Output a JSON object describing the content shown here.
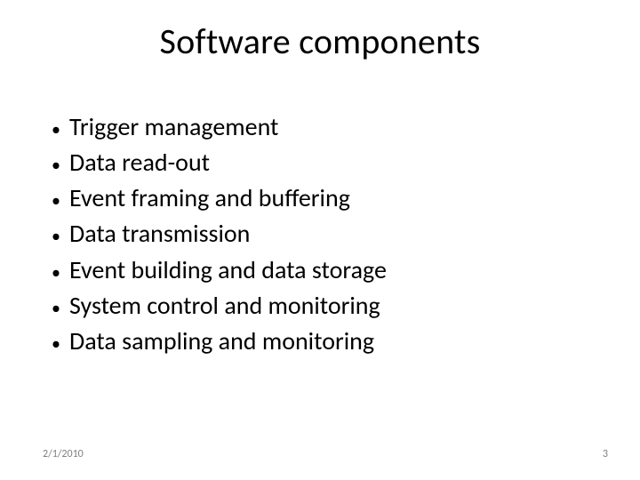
{
  "slide": {
    "title": "Software components",
    "bullets": [
      "Trigger management",
      "Data read-out",
      "Event framing and buffering",
      "Data transmission",
      "Event building and data storage",
      "System control and monitoring",
      "Data sampling and monitoring"
    ],
    "footer": {
      "date": "2/1/2010",
      "page": "3"
    }
  }
}
